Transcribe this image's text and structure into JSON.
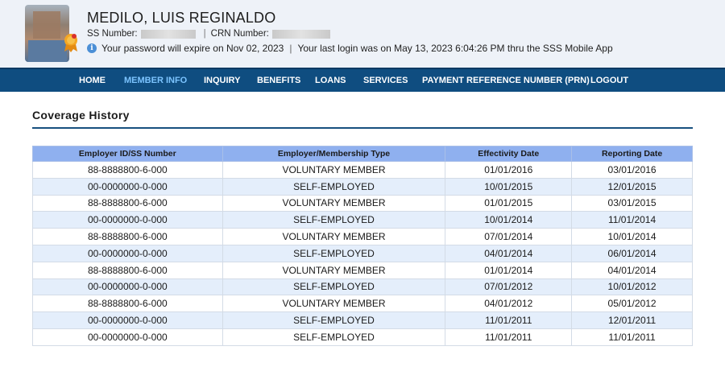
{
  "member": {
    "name": "MEDILO, LUIS REGINALDO",
    "ss_label": "SS Number:",
    "crn_label": "CRN Number:",
    "password_notice": "Your password will expire on Nov 02, 2023",
    "login_notice": "Your last login was on May 13, 2023 6:04:26 PM thru the SSS Mobile App"
  },
  "nav": {
    "items": [
      "HOME",
      "MEMBER INFO",
      "INQUIRY",
      "BENEFITS",
      "LOANS",
      "SERVICES",
      "PAYMENT REFERENCE NUMBER (PRN)",
      "LOGOUT"
    ],
    "active": "MEMBER INFO"
  },
  "page_title": "Coverage History",
  "table": {
    "headers": [
      "Employer ID/SS Number",
      "Employer/Membership Type",
      "Effectivity Date",
      "Reporting Date"
    ],
    "rows": [
      [
        "88-8888800-6-000",
        "VOLUNTARY MEMBER",
        "01/01/2016",
        "03/01/2016"
      ],
      [
        "00-0000000-0-000",
        "SELF-EMPLOYED",
        "10/01/2015",
        "12/01/2015"
      ],
      [
        "88-8888800-6-000",
        "VOLUNTARY MEMBER",
        "01/01/2015",
        "03/01/2015"
      ],
      [
        "00-0000000-0-000",
        "SELF-EMPLOYED",
        "10/01/2014",
        "11/01/2014"
      ],
      [
        "88-8888800-6-000",
        "VOLUNTARY MEMBER",
        "07/01/2014",
        "10/01/2014"
      ],
      [
        "00-0000000-0-000",
        "SELF-EMPLOYED",
        "04/01/2014",
        "06/01/2014"
      ],
      [
        "88-8888800-6-000",
        "VOLUNTARY MEMBER",
        "01/01/2014",
        "04/01/2014"
      ],
      [
        "00-0000000-0-000",
        "SELF-EMPLOYED",
        "07/01/2012",
        "10/01/2012"
      ],
      [
        "88-8888800-6-000",
        "VOLUNTARY MEMBER",
        "04/01/2012",
        "05/01/2012"
      ],
      [
        "00-0000000-0-000",
        "SELF-EMPLOYED",
        "11/01/2011",
        "12/01/2011"
      ],
      [
        "00-0000000-0-000",
        "SELF-EMPLOYED",
        "11/01/2011",
        "11/01/2011"
      ]
    ]
  },
  "colors": {
    "nav_bg": "#0f4d80",
    "nav_active": "#7cc4ff",
    "table_header_bg": "#8fb0ef",
    "row_alt_bg": "#e4eefb",
    "header_bg": "#eef2f8"
  },
  "icons": {
    "notice": "info-icon",
    "badge": "award-badge-icon"
  }
}
